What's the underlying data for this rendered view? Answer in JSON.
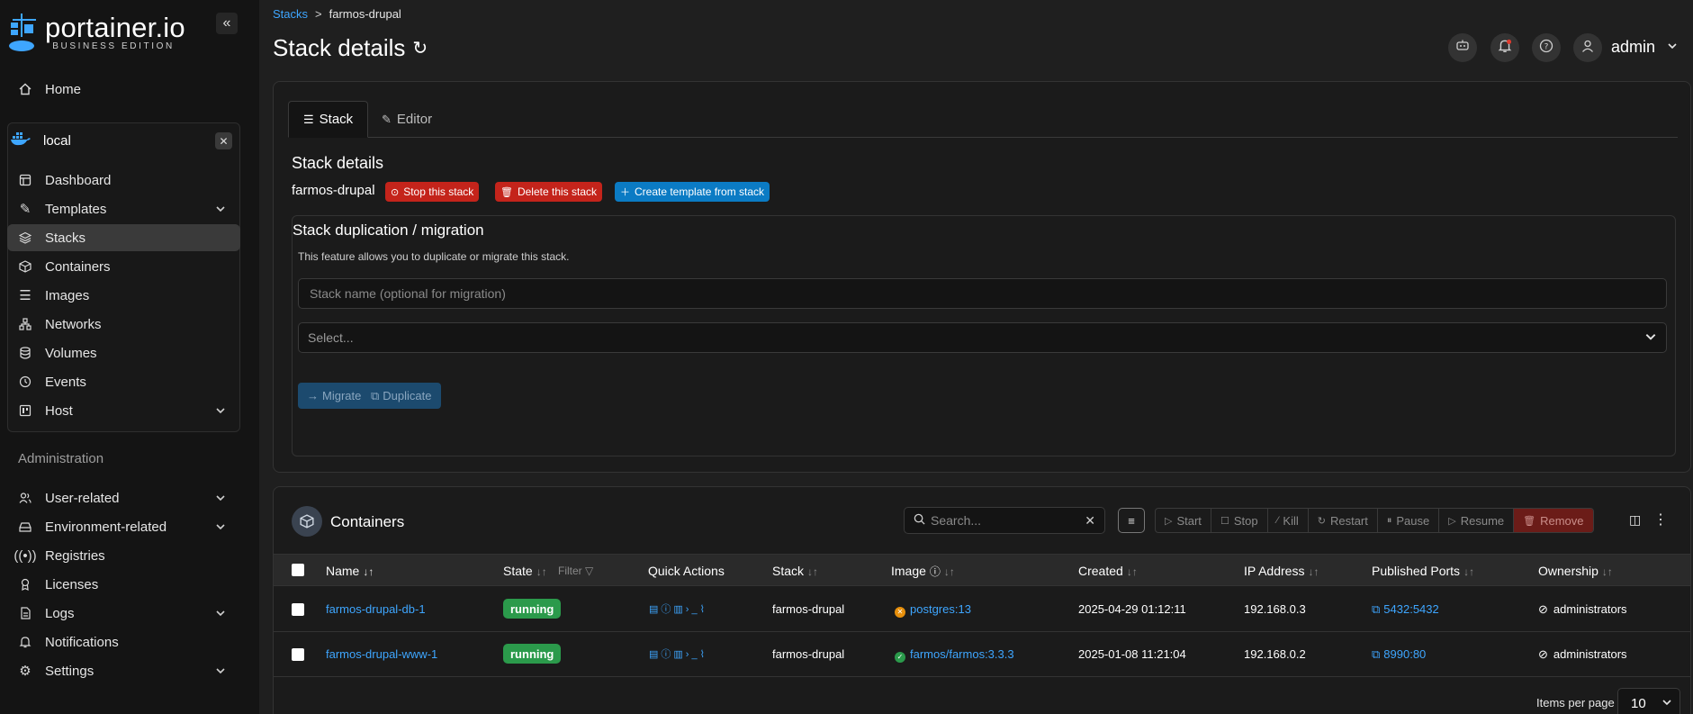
{
  "sidebar": {
    "logo_main": "portainer.io",
    "logo_sub": "BUSINESS EDITION",
    "home": "Home",
    "env_name": "local",
    "env_items": [
      "Dashboard",
      "Templates",
      "Stacks",
      "Containers",
      "Images",
      "Networks",
      "Volumes",
      "Events",
      "Host"
    ],
    "admin_label": "Administration",
    "admin_items": [
      "User-related",
      "Environment-related",
      "Registries",
      "Licenses",
      "Logs",
      "Notifications",
      "Settings"
    ]
  },
  "breadcrumb": {
    "parent": "Stacks",
    "sep": ">",
    "current": "farmos-drupal"
  },
  "header": {
    "title": "Stack details",
    "user": "admin"
  },
  "tabs": [
    "Stack",
    "Editor"
  ],
  "details": {
    "heading": "Stack details",
    "stack_name": "farmos-drupal",
    "stop_label": "Stop this stack",
    "delete_label": "Delete this stack",
    "template_label": "Create template from stack"
  },
  "duplication": {
    "title": "Stack duplication / migration",
    "description": "This feature allows you to duplicate or migrate this stack.",
    "name_placeholder": "Stack name (optional for migration)",
    "select_placeholder": "Select...",
    "migrate_label": "Migrate",
    "duplicate_label": "Duplicate"
  },
  "containers": {
    "title": "Containers",
    "search_placeholder": "Search...",
    "actions": [
      "Start",
      "Stop",
      "Kill",
      "Restart",
      "Pause",
      "Resume",
      "Remove"
    ],
    "columns": [
      "Name",
      "State",
      "Filter",
      "Quick Actions",
      "Stack",
      "Image",
      "Created",
      "IP Address",
      "Published Ports",
      "Ownership"
    ],
    "rows": [
      {
        "name": "farmos-drupal-db-1",
        "state": "running",
        "stack": "farmos-drupal",
        "image": "postgres:13",
        "created": "2025-04-29 01:12:11",
        "ip": "192.168.0.3",
        "ports": "5432:5432",
        "ownership": "administrators"
      },
      {
        "name": "farmos-drupal-www-1",
        "state": "running",
        "stack": "farmos-drupal",
        "image": "farmos/farmos:3.3.3",
        "created": "2025-01-08 11:21:04",
        "ip": "192.168.0.2",
        "ports": "8990:80",
        "ownership": "administrators"
      }
    ],
    "items_per_page_label": "Items per page",
    "items_per_page": "10"
  },
  "colors": {
    "accent": "#3ea6ff",
    "danger": "#c4241b",
    "primary": "#0b7bc4",
    "success": "#2b9a4b"
  }
}
